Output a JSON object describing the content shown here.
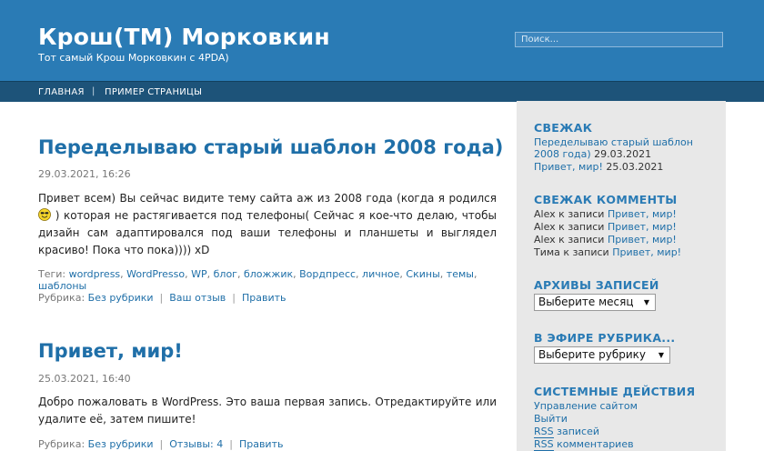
{
  "site": {
    "title": "Крош(TM) Морковкин",
    "description": "Тот самый Крош Морковкин с 4PDA)",
    "search_placeholder": "Поиск..."
  },
  "nav": {
    "items": [
      "ГЛАВНАЯ",
      "ПРИМЕР СТРАНИЦЫ"
    ],
    "separator": "|"
  },
  "posts": [
    {
      "title": "Переделываю старый шаблон 2008 года)",
      "date": "29.03.2021, 16:26",
      "text_before_smiley": "Привет всем) Вы сейчас видите тему сайта аж из 2008 года (когда я родился",
      "text_after_smiley": ") которая не растягивается под телефоны( Сейчас я кое-что делаю, чтобы дизайн сам адаптировался под ваши телефоны и планшеты и выглядел красиво! Пока что пока)))) xD",
      "tags_label": "Теги:",
      "tags": [
        "wordpress",
        "WordPresso",
        "WP",
        "блог",
        "бложжик",
        "Вордпресс",
        "личное",
        "Скины",
        "темы",
        "шаблоны"
      ],
      "category_label": "Рубрика:",
      "category": "Без рубрики",
      "reply": "Ваш отзыв",
      "edit": "Править"
    },
    {
      "title": "Привет, мир!",
      "date": "25.03.2021, 16:40",
      "text": "Добро пожаловать в WordPress. Это ваша первая запись. Отредактируйте или удалите её, затем пишите!",
      "category_label": "Рубрика:",
      "category": "Без рубрики",
      "comments": "Отзывы: 4",
      "edit": "Править"
    }
  ],
  "sidebar": {
    "recent_posts": {
      "heading": "СВЕЖАК",
      "items": [
        {
          "link": "Переделываю старый шаблон 2008 года)",
          "date": "29.03.2021"
        },
        {
          "link": "Привет, мир!",
          "date": "25.03.2021"
        }
      ]
    },
    "recent_comments": {
      "heading": "СВЕЖАК КОММЕНТЫ",
      "connector": "к записи",
      "items": [
        {
          "author": "Alex",
          "post": "Привет, мир!"
        },
        {
          "author": "Alex",
          "post": "Привет, мир!"
        },
        {
          "author": "Alex",
          "post": "Привет, мир!"
        },
        {
          "author": "Тима",
          "post": "Привет, мир!"
        }
      ]
    },
    "archives": {
      "heading": "АРХИВЫ ЗАПИСЕЙ",
      "select": "Выберите месяц"
    },
    "categories": {
      "heading": "В ЭФИРЕ РУБРИКА...",
      "select": "Выберите рубрику"
    },
    "meta": {
      "heading": "СИСТЕМНЫЕ ДЕЙСТВИЯ",
      "items": [
        "Управление сайтом",
        "Выйти"
      ],
      "rss_posts": {
        "abbr": "RSS",
        "rest": "записей"
      },
      "rss_comments": {
        "abbr": "RSS",
        "rest": "комментариев"
      }
    }
  },
  "colors": {
    "header_bg": "#2a7bb5",
    "nav_bg": "#1d5379",
    "link": "#1f6fa8",
    "sidebar_bg": "#e8e8e8"
  }
}
